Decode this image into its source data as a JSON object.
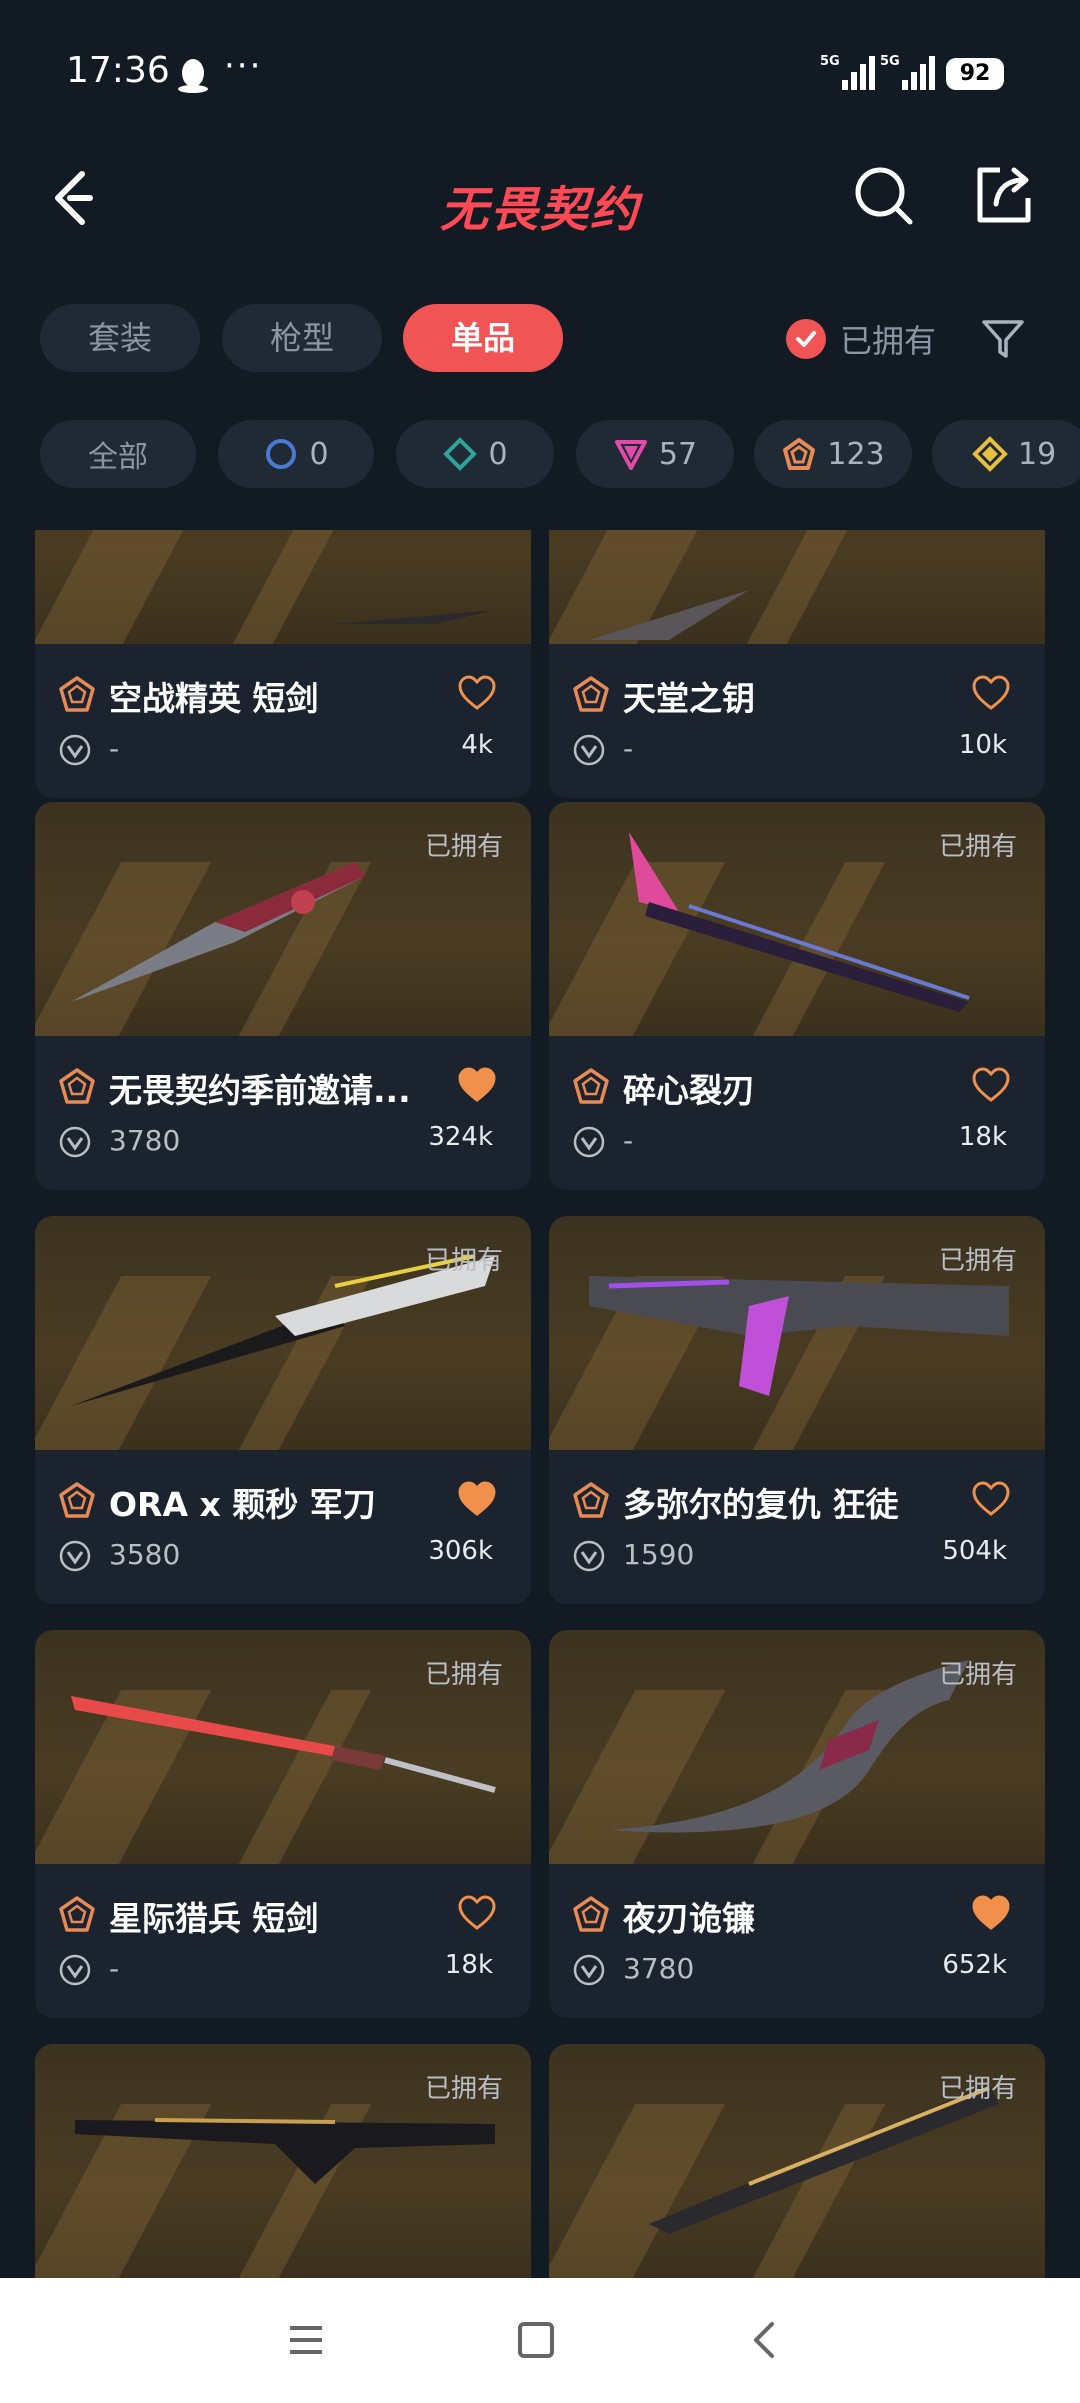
{
  "status": {
    "time": "17:36",
    "dots": "···",
    "battery": "92",
    "net1": "5G",
    "net2": "5G"
  },
  "header": {
    "title": "无畏契约"
  },
  "tabs": [
    {
      "label": "套装",
      "active": false
    },
    {
      "label": "枪型",
      "active": false
    },
    {
      "label": "单品",
      "active": true
    }
  ],
  "owned_filter": {
    "label": "已拥有",
    "checked": true
  },
  "chips": [
    {
      "label": "全部"
    },
    {
      "count": "0",
      "icon": "select-tier-icon"
    },
    {
      "count": "0",
      "icon": "deluxe-tier-icon"
    },
    {
      "count": "57",
      "icon": "premium-tier-icon"
    },
    {
      "count": "123",
      "icon": "exclusive-tier-icon"
    },
    {
      "count": "19",
      "icon": "ultra-tier-icon"
    }
  ],
  "colors": {
    "accent": "#f05454",
    "heart": "#f0904a",
    "tier": "#e88a55",
    "background": "#121a24",
    "card": "#1a232e"
  },
  "cards": [
    {
      "name": "空战精英 短剑",
      "price": "-",
      "likes": "4k",
      "owned": "",
      "liked": false
    },
    {
      "name": "天堂之钥",
      "price": "-",
      "likes": "10k",
      "owned": "",
      "liked": false
    },
    {
      "name": "无畏契约季前邀请...",
      "price": "3780",
      "likes": "324k",
      "owned": "已拥有",
      "liked": true
    },
    {
      "name": "碎心裂刃",
      "price": "-",
      "likes": "18k",
      "owned": "已拥有",
      "liked": false
    },
    {
      "name": "ORA x 颗秒 军刀",
      "price": "3580",
      "likes": "306k",
      "owned": "已拥有",
      "liked": true
    },
    {
      "name": "多弥尔的复仇 狂徒",
      "price": "1590",
      "likes": "504k",
      "owned": "已拥有",
      "liked": false
    },
    {
      "name": "星际猎兵 短剑",
      "price": "-",
      "likes": "18k",
      "owned": "已拥有",
      "liked": false
    },
    {
      "name": "夜刃诡镰",
      "price": "3780",
      "likes": "652k",
      "owned": "已拥有",
      "liked": true
    },
    {
      "name": "",
      "price": "",
      "likes": "",
      "owned": "已拥有",
      "liked": false
    },
    {
      "name": "",
      "price": "",
      "likes": "",
      "owned": "已拥有",
      "liked": false
    }
  ]
}
